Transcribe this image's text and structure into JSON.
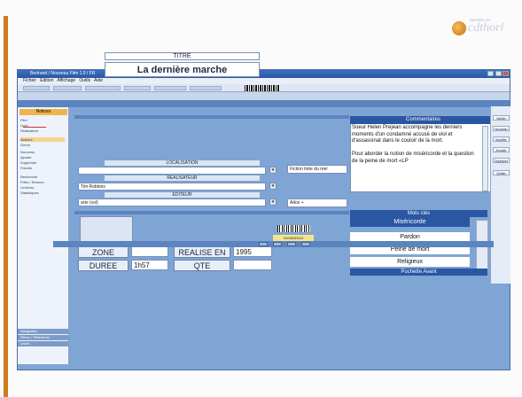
{
  "brand": {
    "logo_text": "cdthorl",
    "logo_small": "ENTRÉE DU"
  },
  "window": {
    "title": "Bertrand / Nouveau Film 1.0 / FR"
  },
  "menu": [
    "Fichier",
    "Edition",
    "Affichage",
    "Outils",
    "Aide"
  ],
  "left_panel": {
    "header": "Notices",
    "items": [
      "Film",
      "Livre",
      "Réalisateur",
      "Acteurs",
      "Genre",
      "Nouveau",
      "Ajouter",
      "Supprimer",
      "Favoris",
      "Recherche",
      "Prêts / Retours",
      "Lecteurs",
      "Statistiques"
    ],
    "bottom": [
      "Navigation",
      "Filtres / Sélections",
      "Listes"
    ]
  },
  "form": {
    "titre_label": "TITRE",
    "title": "La dernière marche",
    "localisation_label": "LOCALISATION",
    "realisateur_label": "REALISATEUR",
    "realisateur_value": "Tim Robbins",
    "editeur_label": "EDITEUR",
    "editeur_value": "arte (vol)",
    "fiction_value": "Fiction tirée du réel",
    "adulte_value": "Ados +",
    "zone_label": "ZONE",
    "duree_label": "DUREE",
    "duree_value": "1h57",
    "realise_en_label": "REALISE EN",
    "realise_en_value": "1995",
    "qte_label": "QTE",
    "barcode_value": "V000000014"
  },
  "comments": {
    "header": "Commentaires",
    "text": "Soeur Helen Prejean accompagne les derniers moments d'un condamné accusé de viol et d'assassinat dans le couloir de la mort.\n\nPour aborder la notion de miséricorde et la question de la peine de mort «LP"
  },
  "keywords": {
    "header": "Mots clés",
    "items": [
      "Miséricorde",
      "Pardon",
      "Peine de mort",
      "Religieux"
    ],
    "footer": "Pochette Avant"
  },
  "right_buttons": [
    "Valider",
    "Nouveau",
    "Modifier",
    "Annuler",
    "Dupliquer",
    "Quitter"
  ],
  "colors": {
    "accent": "#d07a1c",
    "selection": "#2a56a3",
    "app_bg": "#7ea5d4"
  }
}
